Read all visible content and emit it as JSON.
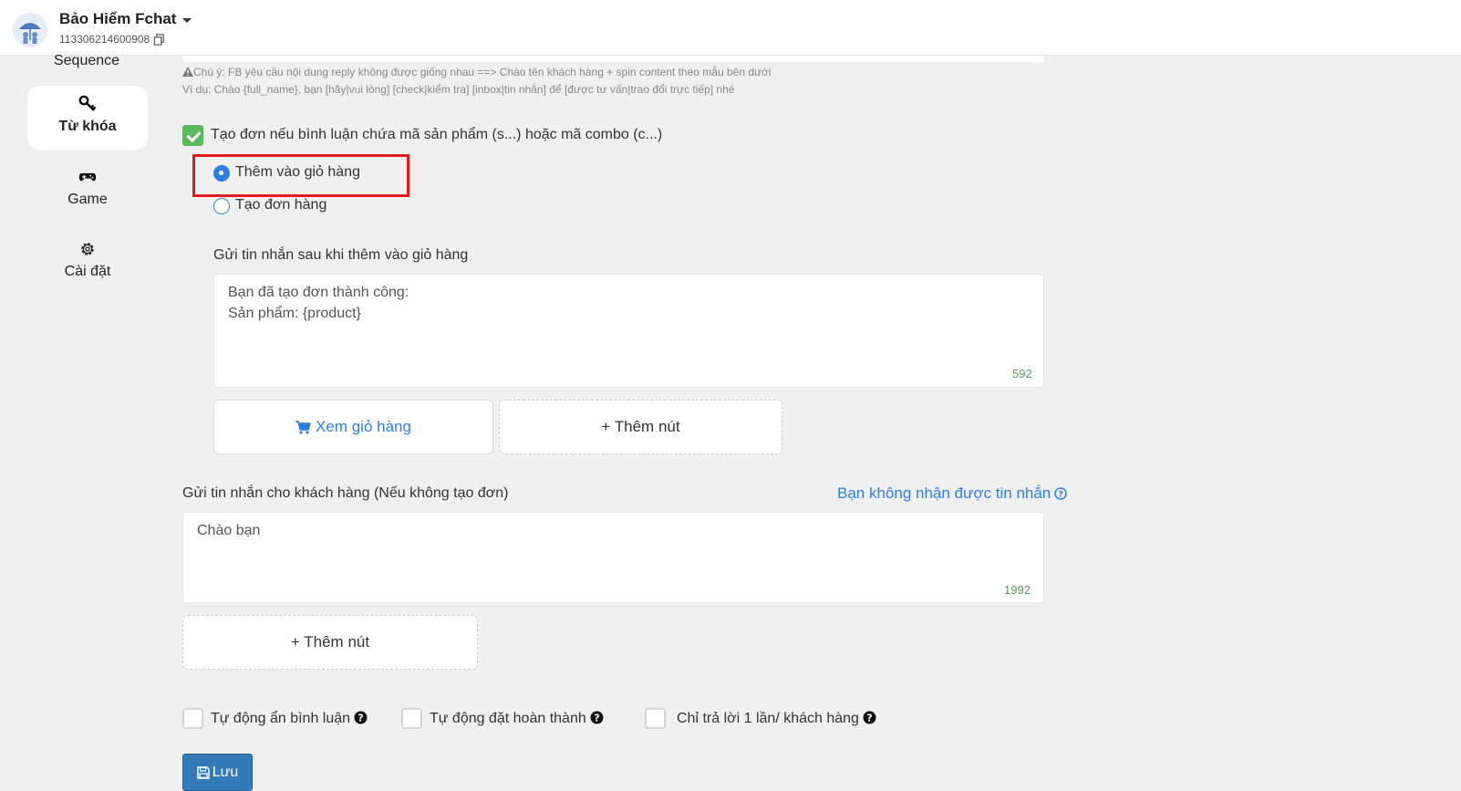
{
  "header": {
    "page_name": "Bảo Hiểm Fchat",
    "page_id": "113306214600908"
  },
  "sidebar": {
    "partial_item": "Sequence",
    "items": [
      {
        "label": "Từ khóa",
        "icon": "key-icon",
        "active": true
      },
      {
        "label": "Game",
        "icon": "gamepad-icon",
        "active": false
      },
      {
        "label": "Cài đặt",
        "icon": "gear-icon",
        "active": false
      }
    ]
  },
  "note": {
    "line1": "Chú ý: FB yêu cầu nội dung reply không được giống nhau ==> Chào tên khách hàng + spin content theo mẫu bên dưới",
    "line2": "Ví dụ: Chào {full_name}, bạn [hãy|vui lòng] [check|kiểm tra] [inbox|tin nhắn] để [được tư vấn|trao đổi trực tiếp] nhé"
  },
  "create_order": {
    "label": "Tạo đơn nếu bình luận chứa mã sản phẩm (s...) hoặc mã combo (c...)",
    "checked": true,
    "options": [
      {
        "label": "Thêm vào giỏ hàng",
        "selected": true
      },
      {
        "label": "Tạo đơn hàng",
        "selected": false
      }
    ]
  },
  "cart_message": {
    "label": "Gửi tin nhắn sau khi thêm vào giỏ hàng",
    "line1": "Bạn đã tạo đơn thành công:",
    "line2": "Sản phẩm: {product}",
    "counter": "592",
    "view_cart_button": "Xem giỏ hàng",
    "add_button": "+ Thêm nút"
  },
  "customer_message": {
    "label": "Gửi tin nhắn cho khách hàng (Nếu không tạo đơn)",
    "help_link": "Bạn không nhận được tin nhắn",
    "value": "Chào bạn",
    "counter": "1992",
    "add_button": "+ Thêm nút"
  },
  "options": [
    {
      "label": "Tự động ẩn bình luận",
      "checked": false
    },
    {
      "label": "Tự động đặt hoàn thành",
      "checked": false
    },
    {
      "label": "Chỉ trả lời 1 lần/ khách hàng",
      "checked": false
    }
  ],
  "save_button": "Lưu",
  "colors": {
    "accent": "#2f80e0",
    "checkbox_checked": "#5cb85c",
    "highlight": "#e01b1b",
    "save": "#337ab7"
  }
}
